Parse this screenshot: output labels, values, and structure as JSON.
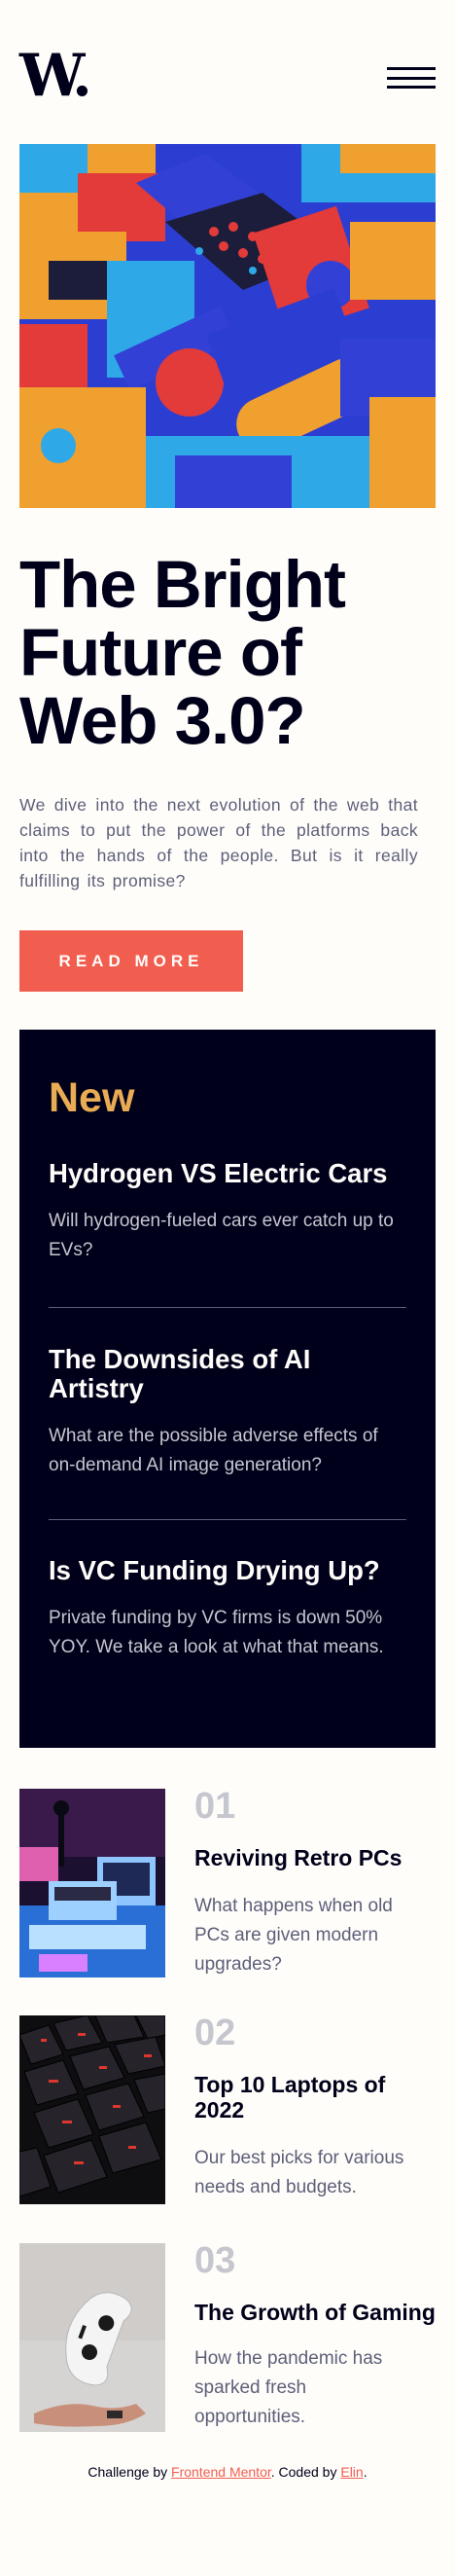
{
  "header": {
    "logo": "W",
    "logo_dot": ".",
    "menu_icon": "hamburger-menu-icon"
  },
  "hero": {
    "image_icon": "abstract-web3-blocks-image",
    "headline": "The Bright Future of Web 3.0?",
    "intro": "We dive into the next evolution of the web that claims to put the power of the platforms back into the hands of the people. But is it really fulfilling its promise?",
    "cta_label": "READ MORE"
  },
  "new_panel": {
    "title": "New",
    "items": [
      {
        "title": "Hydrogen VS Electric Cars",
        "desc": "Will hydrogen-fueled cars ever catch up to EVs?"
      },
      {
        "title": "The Downsides of AI Artistry",
        "desc": "What are the possible adverse effects of on-demand AI image generation?"
      },
      {
        "title": "Is VC Funding Drying Up?",
        "desc": "Private funding by VC firms is down 50% YOY. We take a look at what that means."
      }
    ]
  },
  "trending": [
    {
      "num": "01",
      "title": "Reviving Retro PCs",
      "desc": "What happens when old PCs are given modern upgrades?",
      "image_icon": "retro-pc-image"
    },
    {
      "num": "02",
      "title": "Top 10 Laptops of 2022",
      "desc": "Our best picks for various needs and budgets.",
      "image_icon": "laptop-keyboard-image"
    },
    {
      "num": "03",
      "title": "The Growth of Gaming",
      "desc": "How the pandemic has sparked fresh opportunities.",
      "image_icon": "gaming-controller-image"
    }
  ],
  "footer": {
    "prefix": "Challenge by ",
    "link1": "Frontend Mentor",
    "middle": ". Coded by ",
    "link2": "Elin",
    "suffix": "."
  },
  "colors": {
    "accent_red": "#f15e50",
    "accent_orange": "#e9ab53",
    "dark_navy": "#00001a",
    "gray_blue": "#5d5f79",
    "off_white": "#fffdfa"
  }
}
